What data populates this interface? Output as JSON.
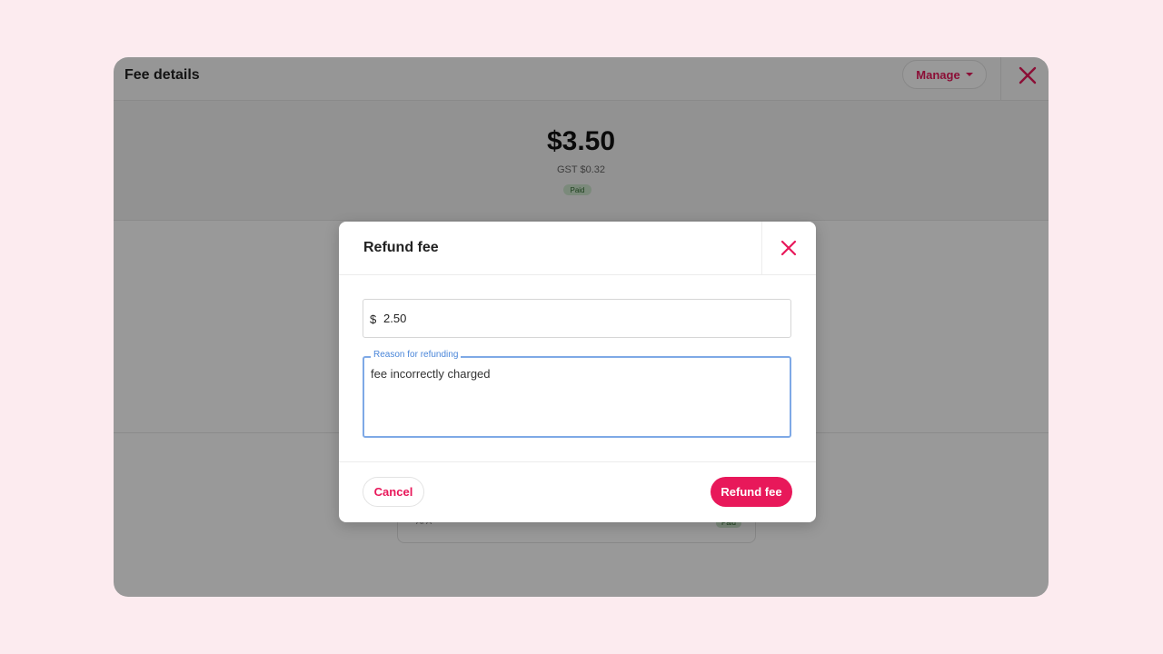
{
  "window": {
    "title": "Fee details",
    "manage_label": "Manage",
    "close_icon": "close-icon"
  },
  "summary": {
    "amount": "$3.50",
    "gst": "GST $0.32",
    "status": "Paid"
  },
  "card": {
    "label": "AFA",
    "status": "Paid"
  },
  "modal": {
    "title": "Refund fee",
    "close_icon": "close-icon",
    "amount_field": {
      "currency_symbol": "$",
      "value": "2.50"
    },
    "reason_field": {
      "label": "Reason for refunding",
      "value": "fee incorrectly charged"
    },
    "cancel_label": "Cancel",
    "submit_label": "Refund fee"
  },
  "colors": {
    "accent": "#e8185a",
    "focus": "#7ea9e6",
    "paid_badge": "#cde6cd"
  }
}
